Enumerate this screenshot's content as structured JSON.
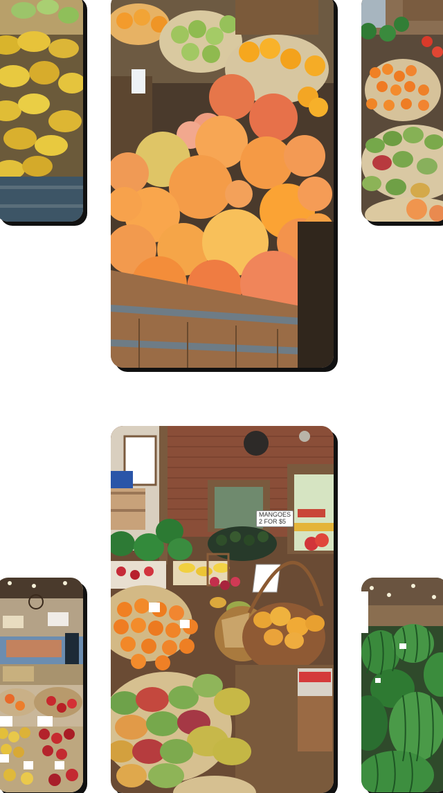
{
  "gallery": {
    "items": [
      {
        "subject": "mangoes-in-basket"
      },
      {
        "subject": "grapefruit-and-oranges-in-barrel"
      },
      {
        "subject": "melons-oranges-avocados"
      },
      {
        "subject": "market-overview-apples"
      },
      {
        "subject": "produce-stand-with-baskets",
        "sign_line1": "MANGOES",
        "sign_line2": "2 FOR $5"
      },
      {
        "subject": "watermelons"
      }
    ]
  },
  "colors": {
    "background": "#ffffff",
    "shadow": "#111111",
    "orange": "#f0973c",
    "grapefruit": "#f3a15a",
    "mango_yellow": "#e7c33a",
    "lime_green": "#8fbf5a",
    "barrel_wood": "#8a6040",
    "watermelon_green": "#2f7b34"
  }
}
